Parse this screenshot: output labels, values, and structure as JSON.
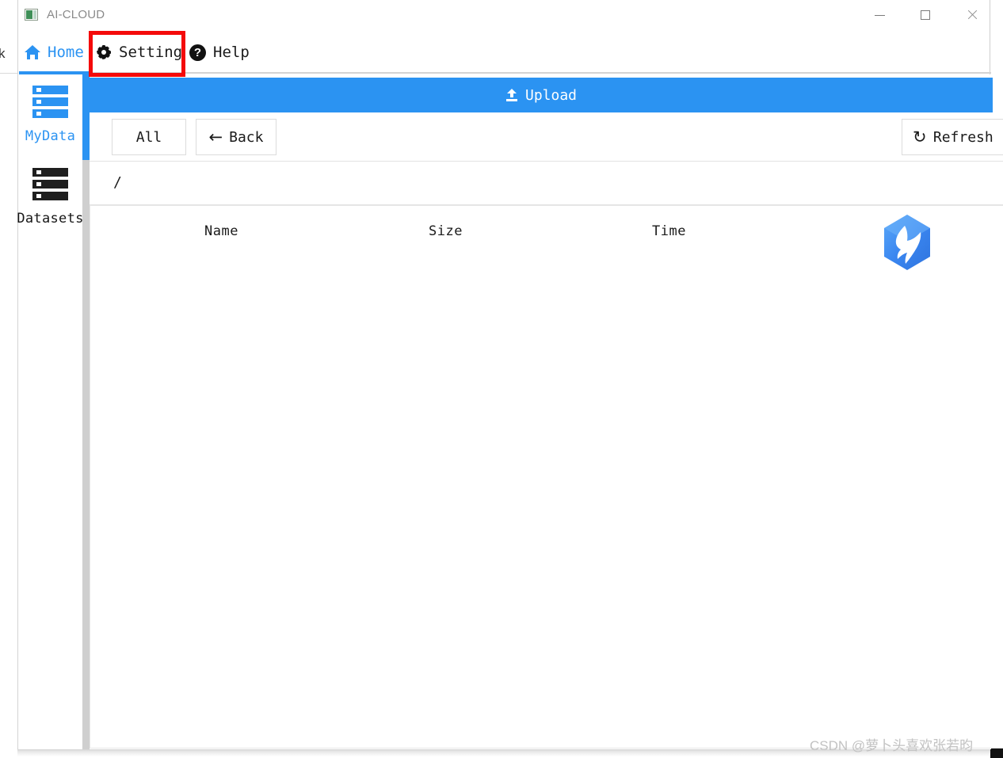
{
  "window": {
    "app_icon": "app-window-icon",
    "title": "AI-CLOUD",
    "controls": {
      "minimize": "minimize-icon",
      "maximize": "maximize-icon",
      "close": "close-icon"
    }
  },
  "background": {
    "left_fragment_text": "k"
  },
  "nav": {
    "items": [
      {
        "label": "Home",
        "icon": "home-icon",
        "active": true
      },
      {
        "label": "Setting",
        "icon": "gear-icon",
        "active": false,
        "highlighted": true
      },
      {
        "label": "Help",
        "icon": "question-mark-icon",
        "active": false
      }
    ],
    "help_glyph": "?"
  },
  "sidebar": {
    "items": [
      {
        "label": "MyData",
        "icon": "server-stack-icon",
        "active": true
      },
      {
        "label": "Datasets",
        "icon": "server-stack-icon",
        "active": false
      }
    ]
  },
  "main": {
    "upload": {
      "label": "Upload",
      "icon": "upload-arrow-icon"
    },
    "toolbar": {
      "all_label": "All",
      "back_label": "Back",
      "back_icon": "arrow-left-icon",
      "back_glyph": "←",
      "refresh_label": "Refresh",
      "refresh_icon": "refresh-icon",
      "refresh_glyph": "↺"
    },
    "breadcrumb": {
      "path": "/"
    },
    "table": {
      "columns": [
        "Name",
        "Size",
        "Time"
      ],
      "rows": []
    },
    "brand_logo": "hexagon-bird-logo"
  },
  "watermark": {
    "text": "CSDN @萝卜头喜欢张若昀"
  },
  "colors": {
    "accent_blue": "#2b93f2",
    "highlight_red": "#f40a0a",
    "text_dark": "#1a1a1a",
    "title_gray": "#8a8a8a",
    "border_gray": "#dcdcdc",
    "watermark_gray": "#c2c2c2"
  }
}
